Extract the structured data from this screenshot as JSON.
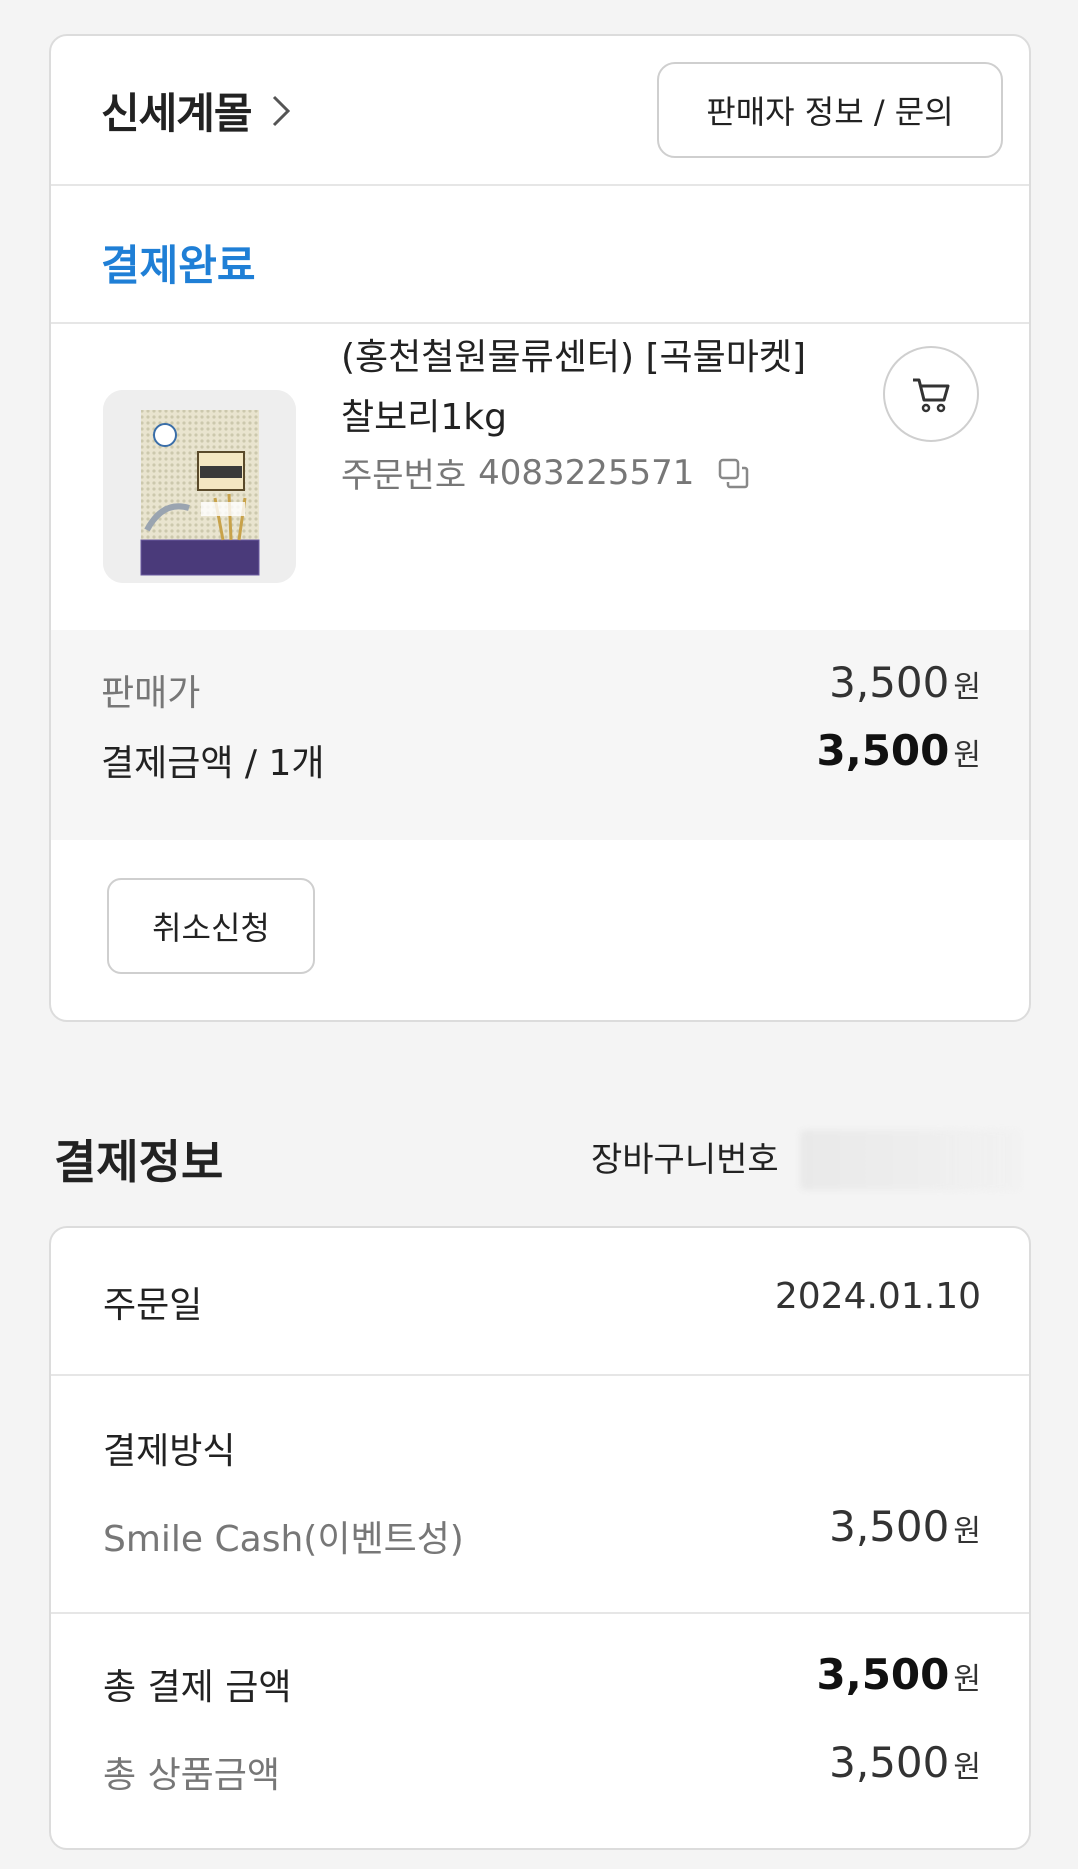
{
  "store": {
    "name": "신세계몰",
    "seller_button": "판매자 정보 / 문의"
  },
  "order": {
    "status": "결제완료",
    "product_title": "(홍천철원물류센터) [곡물마켓] 찰보리1kg",
    "order_number_label": "주문번호",
    "order_number": "4083225571",
    "thumb_label": "곡물마켓",
    "sale_price_label": "판매가",
    "sale_price": "3,500",
    "payment_amount_label": "결제금액 / 1개",
    "payment_amount": "3,500",
    "currency": "원",
    "cancel_button": "취소신청"
  },
  "payment_info": {
    "title": "결제정보",
    "basket_label": "장바구니번호",
    "order_date_label": "주문일",
    "order_date": "2024.01.10",
    "method_label": "결제방식",
    "method_name": "Smile Cash(이벤트성)",
    "method_amount": "3,500",
    "total_payment_label": "총 결제 금액",
    "total_payment": "3,500",
    "total_product_label": "총 상품금액",
    "total_product": "3,500",
    "currency": "원"
  },
  "colors": {
    "status_blue": "#1f7fd6",
    "thumb_purple": "#4a3a7a"
  },
  "icons": [
    "chevron-right-icon",
    "cart-icon",
    "copy-icon"
  ]
}
